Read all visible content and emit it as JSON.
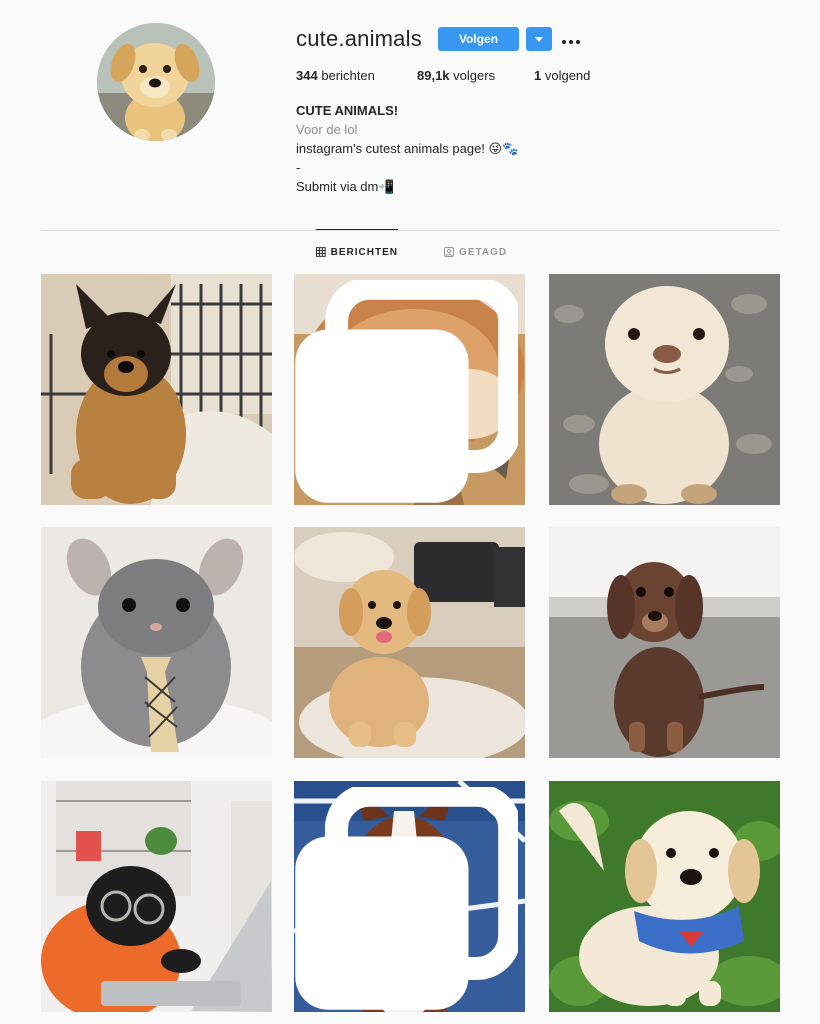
{
  "profile": {
    "username": "cute.animals",
    "follow_label": "Volgen",
    "dropdown_icon": "caret-down-icon",
    "more_icon": "more-options-icon",
    "stats": {
      "posts_count": "344",
      "posts_label": " berichten",
      "followers_count": "89,1k",
      "followers_label": " volgers",
      "following_count": "1",
      "following_label": " volgend"
    },
    "bio": {
      "full_name": "CUTE ANIMALS!",
      "category": "Voor de lol",
      "line1": "instagram's cutest animals page! 😜🐾",
      "line2": "-",
      "line3": "Submit via dm📲"
    }
  },
  "tabs": [
    {
      "label": "BERICHTEN",
      "icon": "grid-icon",
      "active": true
    },
    {
      "label": "GETAGD",
      "icon": "tag-icon",
      "active": false
    }
  ],
  "posts": [
    {
      "subject": "german-shepherd-puppy-in-cart",
      "multiple": false
    },
    {
      "subject": "fluffy-chow-puppy",
      "multiple": true
    },
    {
      "subject": "baby-seal",
      "multiple": false
    },
    {
      "subject": "chinchilla-with-tie",
      "multiple": false
    },
    {
      "subject": "golden-retriever-puppy",
      "multiple": false
    },
    {
      "subject": "dachshund-puppy",
      "multiple": false
    },
    {
      "subject": "pug-in-hoodie-at-laptop",
      "multiple": false
    },
    {
      "subject": "australian-shepherd-on-court",
      "multiple": true
    },
    {
      "subject": "golden-puppy-in-superman-harness",
      "multiple": false
    }
  ],
  "colors": {
    "background": "#fafafa",
    "accent": "#3897f0",
    "text": "#262626",
    "muted": "#8e8e8e",
    "divider": "#dbdbdb"
  }
}
